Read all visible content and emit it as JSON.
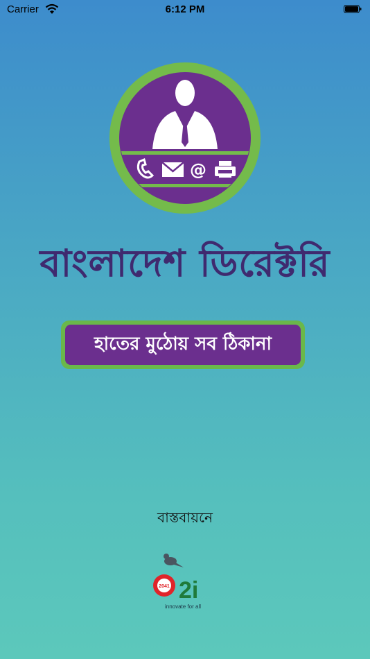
{
  "status_bar": {
    "carrier": "Carrier",
    "time": "6:12 PM"
  },
  "app": {
    "title": "বাংলাদেশ ডিরেক্টরি",
    "tagline": "হাতের মুঠোয় সব ঠিকানা"
  },
  "footer": {
    "implemented_by": "বাস্তবায়নে",
    "partner_logo": {
      "code": "a2i",
      "year": "2041",
      "slogan": "innovate for all"
    }
  },
  "colors": {
    "purple": "#6b2f8e",
    "green": "#6ab84a",
    "title": "#3f2a6f"
  },
  "icons": [
    "wifi-icon",
    "battery-icon",
    "person-icon",
    "phone-icon",
    "mail-icon",
    "at-icon",
    "fax-icon",
    "bird-icon"
  ]
}
